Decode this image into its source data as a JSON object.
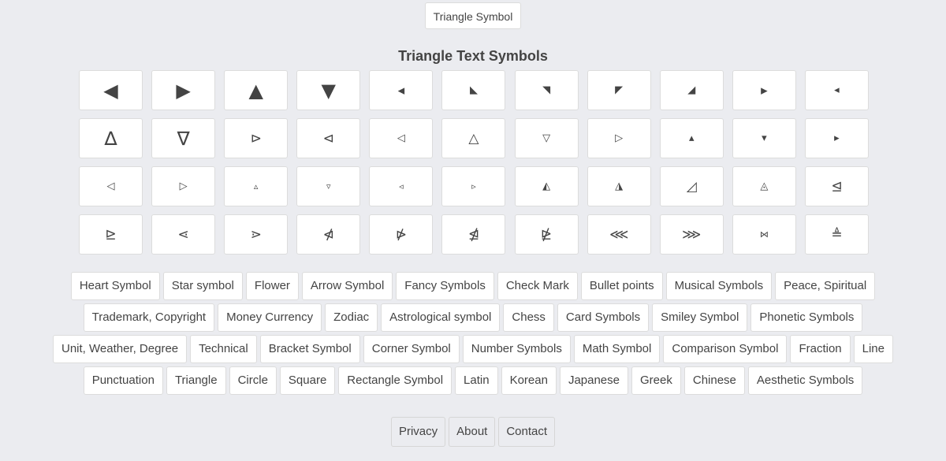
{
  "header": {
    "top_button": "Triangle Symbol",
    "title": "Triangle Text Symbols"
  },
  "symbols": [
    {
      "ch": "◀",
      "size": "lg"
    },
    {
      "ch": "▶",
      "size": "lg"
    },
    {
      "ch": "▲",
      "size": "lg"
    },
    {
      "ch": "▼",
      "size": "lg"
    },
    {
      "ch": "◂",
      "size": "md"
    },
    {
      "ch": "◣",
      "size": "sm"
    },
    {
      "ch": "◥",
      "size": "sm"
    },
    {
      "ch": "◤",
      "size": "sm"
    },
    {
      "ch": "◢",
      "size": "sm"
    },
    {
      "ch": "▸",
      "size": "md"
    },
    {
      "ch": "◂",
      "size": "sm"
    },
    {
      "ch": "∆",
      "size": "lg"
    },
    {
      "ch": "∇",
      "size": "lg"
    },
    {
      "ch": "⊳",
      "size": "md"
    },
    {
      "ch": "⊲",
      "size": "md"
    },
    {
      "ch": "◁",
      "size": "sm"
    },
    {
      "ch": "△",
      "size": "md"
    },
    {
      "ch": "▽",
      "size": "sm"
    },
    {
      "ch": "▷",
      "size": "sm"
    },
    {
      "ch": "▴",
      "size": "sm"
    },
    {
      "ch": "▾",
      "size": "sm"
    },
    {
      "ch": "▸",
      "size": "sm"
    },
    {
      "ch": "◁",
      "size": "sm"
    },
    {
      "ch": "▷",
      "size": "sm"
    },
    {
      "ch": "▵",
      "size": "xs"
    },
    {
      "ch": "▿",
      "size": "xs"
    },
    {
      "ch": "◃",
      "size": "xs"
    },
    {
      "ch": "▹",
      "size": "xs"
    },
    {
      "ch": "◭",
      "size": "sm"
    },
    {
      "ch": "◮",
      "size": "sm"
    },
    {
      "ch": "◿",
      "size": "md"
    },
    {
      "ch": "◬",
      "size": "sm"
    },
    {
      "ch": "⊴",
      "size": "md"
    },
    {
      "ch": "⊵",
      "size": "md"
    },
    {
      "ch": "⋖",
      "size": "md"
    },
    {
      "ch": "⋗",
      "size": "md"
    },
    {
      "ch": "⋪",
      "size": "md"
    },
    {
      "ch": "⋫",
      "size": "md"
    },
    {
      "ch": "⋬",
      "size": "md"
    },
    {
      "ch": "⋭",
      "size": "md"
    },
    {
      "ch": "⋘",
      "size": "md"
    },
    {
      "ch": "⋙",
      "size": "md"
    },
    {
      "ch": "⋈",
      "size": "xs"
    },
    {
      "ch": "≜",
      "size": "md"
    }
  ],
  "tag_rows": [
    [
      "Heart Symbol",
      "Star symbol",
      "Flower",
      "Arrow Symbol",
      "Fancy Symbols",
      "Check Mark",
      "Bullet points",
      "Musical Symbols",
      "Peace, Spiritual"
    ],
    [
      "Trademark, Copyright",
      "Money Currency",
      "Zodiac",
      "Astrological symbol",
      "Chess",
      "Card Symbols",
      "Smiley Symbol",
      "Phonetic Symbols"
    ],
    [
      "Unit, Weather, Degree",
      "Technical",
      "Bracket Symbol",
      "Corner Symbol",
      "Number Symbols",
      "Math Symbol",
      "Comparison Symbol",
      "Fraction",
      "Line"
    ],
    [
      "Punctuation",
      "Triangle",
      "Circle",
      "Square",
      "Rectangle Symbol",
      "Latin",
      "Korean",
      "Japanese",
      "Greek",
      "Chinese",
      "Aesthetic Symbols"
    ]
  ],
  "footer": [
    "Privacy",
    "About",
    "Contact"
  ]
}
